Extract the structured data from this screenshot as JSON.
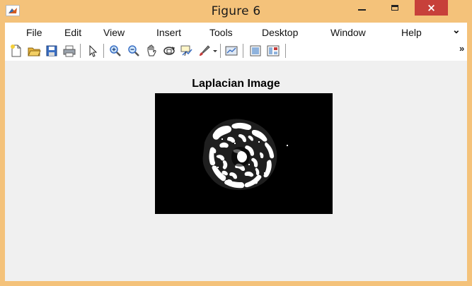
{
  "window": {
    "title": "Figure 6",
    "accent_color": "#f4c27a",
    "close_color": "#c7403a",
    "minimize_glyph": "–",
    "close_glyph": "×"
  },
  "menu": {
    "items": [
      "File",
      "Edit",
      "View",
      "Insert",
      "Tools",
      "Desktop",
      "Window",
      "Help"
    ],
    "overflow_glyph": "⌄"
  },
  "toolbar": {
    "icons": [
      "new-figure-icon",
      "open-file-icon",
      "save-icon",
      "print-icon",
      "pointer-icon",
      "zoom-in-icon",
      "zoom-out-icon",
      "pan-icon",
      "rotate-3d-icon",
      "data-cursor-icon",
      "brush-icon",
      "dropdown-arrow-icon",
      "link-plot-icon",
      "hide-plot-tools-icon",
      "show-plot-tools-icon"
    ],
    "overflow_glyph": "»"
  },
  "axes": {
    "title": "Laplacian Image",
    "background": "#000000",
    "foreground": "#ffffff"
  }
}
